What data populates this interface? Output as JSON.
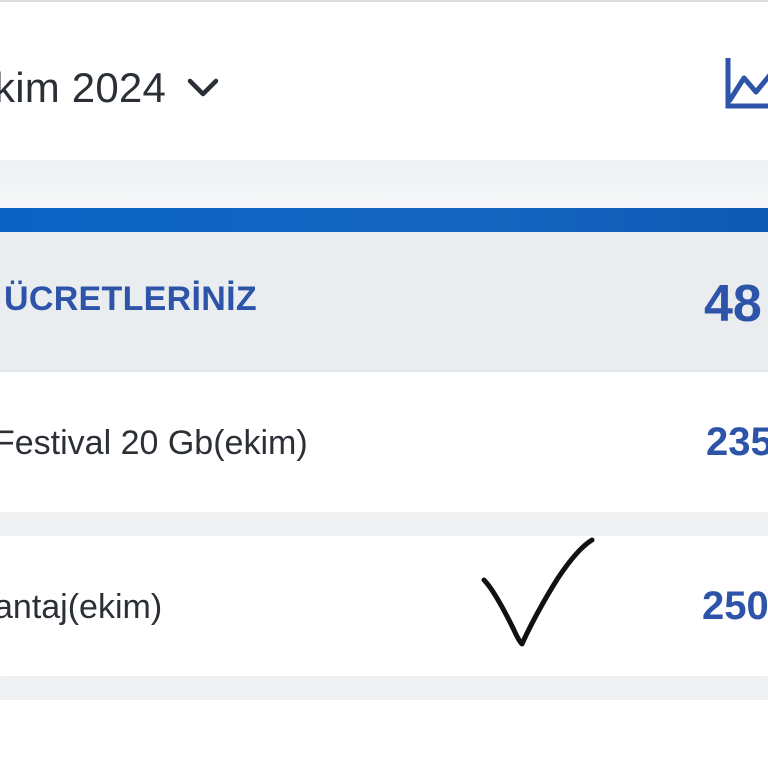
{
  "header": {
    "month_label": "kim 2024",
    "chevron_icon": "chevron-down-icon",
    "chart_icon": "line-chart-icon"
  },
  "summary": {
    "title": "ÜCRETLERİNİZ",
    "amount": "48"
  },
  "items": [
    {
      "label": "Festival 20 Gb(ekim)",
      "amount": "235"
    },
    {
      "label": "antaj(ekim)",
      "amount": "250"
    }
  ],
  "annotation": {
    "checkmark_icon": "handwritten-checkmark-icon"
  },
  "colors": {
    "accent_blue": "#1565c0",
    "amount_blue": "#2d54a8",
    "summary_bg": "#eaedf0",
    "text_dark": "#2b2f36"
  }
}
